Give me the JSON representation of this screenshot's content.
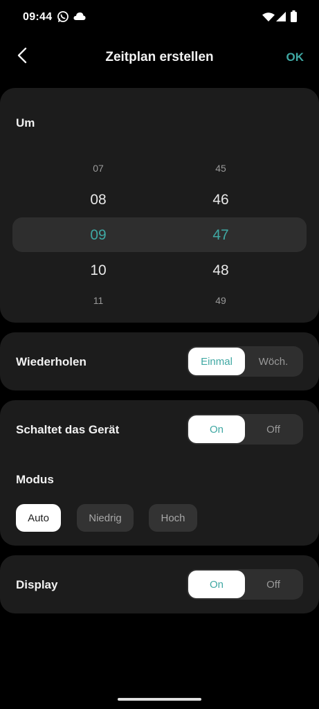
{
  "status_bar": {
    "time": "09:44",
    "icons": [
      "whatsapp-icon",
      "cloud-icon",
      "wifi-icon",
      "signal-icon",
      "battery-icon"
    ]
  },
  "header": {
    "back_icon": "chevron-left-icon",
    "title": "Zeitplan erstellen",
    "ok_label": "OK"
  },
  "time_picker": {
    "label": "Um",
    "hours": [
      "07",
      "08",
      "09",
      "10",
      "11"
    ],
    "minutes": [
      "45",
      "46",
      "47",
      "48",
      "49"
    ],
    "selected_hour": "09",
    "selected_minute": "47"
  },
  "repeat": {
    "label": "Wiederholen",
    "options": [
      "Einmal",
      "Wöch."
    ],
    "selected": "Einmal"
  },
  "device_switch": {
    "label": "Schaltet das Gerät",
    "options": [
      "On",
      "Off"
    ],
    "selected": "On"
  },
  "mode": {
    "label": "Modus",
    "options": [
      "Auto",
      "Niedrig",
      "Hoch"
    ],
    "selected": "Auto"
  },
  "display": {
    "label": "Display",
    "options": [
      "On",
      "Off"
    ],
    "selected": "On"
  },
  "colors": {
    "accent": "#3fa8a3",
    "background": "#000000",
    "card": "#1c1c1c"
  }
}
